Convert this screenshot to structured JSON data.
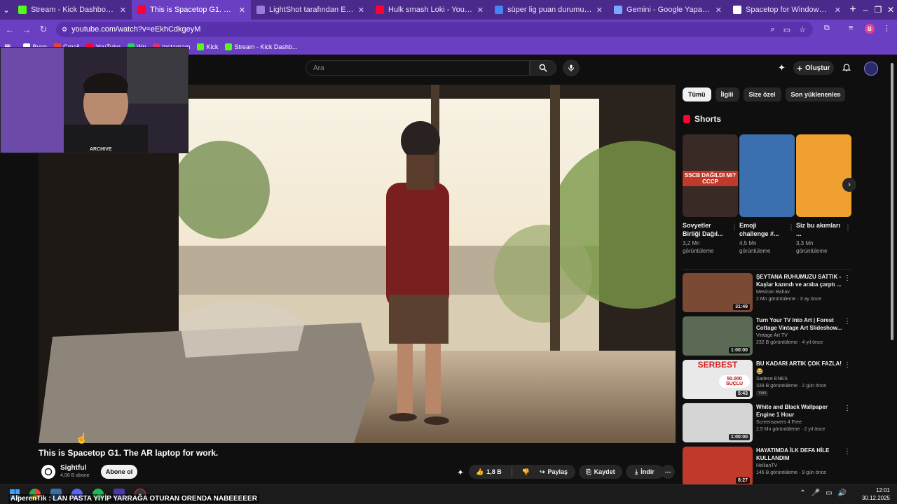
{
  "browser": {
    "tabs": [
      {
        "label": "Stream - Kick Dashboard",
        "active": false,
        "fav_color": "#53fc18"
      },
      {
        "label": "This is Spacetop G1. The AR lap",
        "active": true,
        "fav_color": "#ff0033"
      },
      {
        "label": "LightShot tarafından Ekran Gör",
        "active": false,
        "fav_color": "#9c7bdc"
      },
      {
        "label": "Hulk smash Loki - YouTube",
        "active": false,
        "fav_color": "#ff0033"
      },
      {
        "label": "süper lig puan durumu - Googl",
        "active": false,
        "fav_color": "#4285f4"
      },
      {
        "label": "Gemini - Google Yapay Zeka'ya",
        "active": false,
        "fav_color": "#7aa7ff"
      },
      {
        "label": "Spacetop for Windows | AR So",
        "active": false,
        "fav_color": "#ffffff"
      }
    ],
    "url": "youtube.com/watch?v=eEkhCdkgeyM",
    "profile_letter": "B",
    "bookmarks": [
      {
        "label": "Bypo",
        "color": "#ffffff"
      },
      {
        "label": "Gmail",
        "color": "#ea4335"
      },
      {
        "label": "YouTube",
        "color": "#ff0033"
      },
      {
        "label": "Wp",
        "color": "#25d366"
      },
      {
        "label": "Instagram",
        "color": "#e1306c"
      },
      {
        "label": "Kick",
        "color": "#53fc18"
      },
      {
        "label": "Stream - Kick Dashb...",
        "color": "#53fc18"
      }
    ]
  },
  "youtube": {
    "search_placeholder": "Ara",
    "create_label": "Oluştur",
    "video": {
      "title": "This is Spacetop G1. The AR laptop for work.",
      "channel": "Sightful",
      "subscribers": "4,06 B abone",
      "subscribe_label": "Abone ol",
      "likes": "1,8 B",
      "share_label": "Paylaş",
      "save_label": "Kaydet",
      "download_label": "İndir",
      "webcam_watermark": "ARCHIVE"
    },
    "chips": [
      {
        "label": "Tümü",
        "active": true
      },
      {
        "label": "İlgili",
        "active": false
      },
      {
        "label": "Size özel",
        "active": false
      },
      {
        "label": "Son yüklenenler",
        "active": false
      }
    ],
    "shorts_heading": "Shorts",
    "shorts": [
      {
        "title": "Sovyetler Birliği Dağıl...",
        "views": "3,2 Mn görüntüleme",
        "overlay": "SSCB DAĞILDI MI? CCCP",
        "bg": "#3a2a25"
      },
      {
        "title": "Emoji challenge #...",
        "views": "4,5 Mn görüntüleme",
        "overlay": "",
        "bg": "#3b6fb0"
      },
      {
        "title": "Siz bu akımları ...",
        "views": "3,3 Mn görüntüleme",
        "overlay": "",
        "bg": "#f0a030"
      }
    ],
    "recommendations": [
      {
        "title": "ŞEYTANA RUHUMUZU SATTIK - Kaşlar kazındı ve araba çarptı ...",
        "channel": "Mevlcan Bahav",
        "meta": "2 Mn görüntüleme · 3 ay önce",
        "duration": "31:49",
        "bg": "#7a4a35",
        "badge": ""
      },
      {
        "title": "Turn Your TV Into Art | Forest Cottage Vintage Art Slideshow...",
        "channel": "Vintage Art TV",
        "meta": "232 B görüntüleme · 4 yıl önce",
        "duration": "1:00:00",
        "bg": "#5a6a55",
        "badge": ""
      },
      {
        "title": "BU KADARI ARTIK ÇOK FAZLA! 😂",
        "channel": "Sadece ENES",
        "meta": "339 B görüntüleme · 2 gün önce",
        "duration": "5:43",
        "bg": "#e9e9e9",
        "badge": "Yeni",
        "overlay_top": "SERBEST",
        "overlay_mid": "50.000 SUÇLU"
      },
      {
        "title": "White and Black Wallpaper Engine 1 Hour",
        "channel": "Screensavers 4 Free",
        "meta": "2,5 Mn görüntüleme · 2 yıl önce",
        "duration": "1:00:00",
        "bg": "#d5d5d5",
        "badge": ""
      },
      {
        "title": "HAYATIMDA İLK DEFA HİLE KULLANDIM",
        "channel": "HellianTV",
        "meta": "146 B görüntüleme · 9 gün önce",
        "duration": "8:27",
        "bg": "#c0392b",
        "badge": ""
      }
    ]
  },
  "taskbar": {
    "marquee": "AlperenTik : LAN PASTA YİYİP YARRAĞA OTURAN ORENDA NABEEEEER",
    "time": "12:01",
    "date": "30.12.2025"
  }
}
